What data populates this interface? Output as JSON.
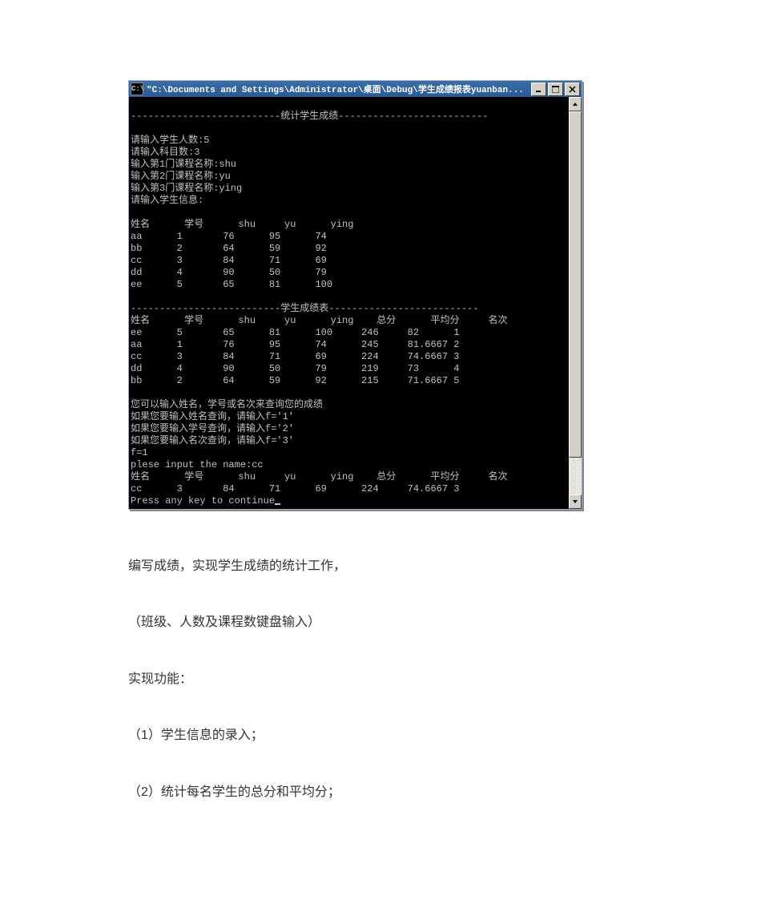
{
  "window": {
    "icon_label": "C:\\",
    "title": "\"C:\\Documents and Settings\\Administrator\\桌面\\Debug\\学生成绩报表yuanban..."
  },
  "console": {
    "section1_title": "--------------------------统计学生成绩--------------------------",
    "prompt_students": "请输入学生人数:5",
    "prompt_subjects": "请输入科目数:3",
    "prompt_course1": "输入第1门课程名称:shu",
    "prompt_course2": "输入第2门课程名称:yu",
    "prompt_course3": "输入第3门课程名称:ying",
    "prompt_info": "请输入学生信息:",
    "input_table": {
      "header": [
        "姓名",
        "学号",
        "shu",
        "yu",
        "ying"
      ],
      "rows": [
        [
          "aa",
          "1",
          "76",
          "95",
          "74"
        ],
        [
          "bb",
          "2",
          "64",
          "59",
          "92"
        ],
        [
          "cc",
          "3",
          "84",
          "71",
          "69"
        ],
        [
          "dd",
          "4",
          "90",
          "50",
          "79"
        ],
        [
          "ee",
          "5",
          "65",
          "81",
          "100"
        ]
      ]
    },
    "section2_title": "--------------------------学生成绩表--------------------------",
    "result_table": {
      "header": [
        "姓名",
        "学号",
        "shu",
        "yu",
        "ying",
        "总分",
        "平均分",
        "名次"
      ],
      "rows": [
        [
          "ee",
          "5",
          "65",
          "81",
          "100",
          "246",
          "82",
          "1"
        ],
        [
          "aa",
          "1",
          "76",
          "95",
          "74",
          "245",
          "81.6667",
          "2"
        ],
        [
          "cc",
          "3",
          "84",
          "71",
          "69",
          "224",
          "74.6667",
          "3"
        ],
        [
          "dd",
          "4",
          "90",
          "50",
          "79",
          "219",
          "73",
          "4"
        ],
        [
          "bb",
          "2",
          "64",
          "59",
          "92",
          "215",
          "71.6667",
          "5"
        ]
      ]
    },
    "query_hint": "您可以输入姓名，学号或名次来查询您的成绩",
    "query_opt1": "如果您要输入姓名查询，请输入f='1'",
    "query_opt2": "如果您要输入学号查询，请输入f='2'",
    "query_opt3": "如果您要输入名次查询，请输入f='3'",
    "f_input": "f=1",
    "name_prompt": "plese input the name:cc",
    "query_result": {
      "header": [
        "姓名",
        "学号",
        "shu",
        "yu",
        "ying",
        "总分",
        "平均分",
        "名次"
      ],
      "row": [
        "cc",
        "3",
        "84",
        "71",
        "69",
        "224",
        "74.6667",
        "3"
      ]
    },
    "press_key": "Press any key to continue"
  },
  "doc": {
    "p1": "编写成绩，实现学生成绩的统计工作，",
    "p2": "（班级、人数及课程数键盘输入）",
    "p3": "实现功能：",
    "p4": "（1）学生信息的录入；",
    "p5": "（2）统计每名学生的总分和平均分；"
  }
}
